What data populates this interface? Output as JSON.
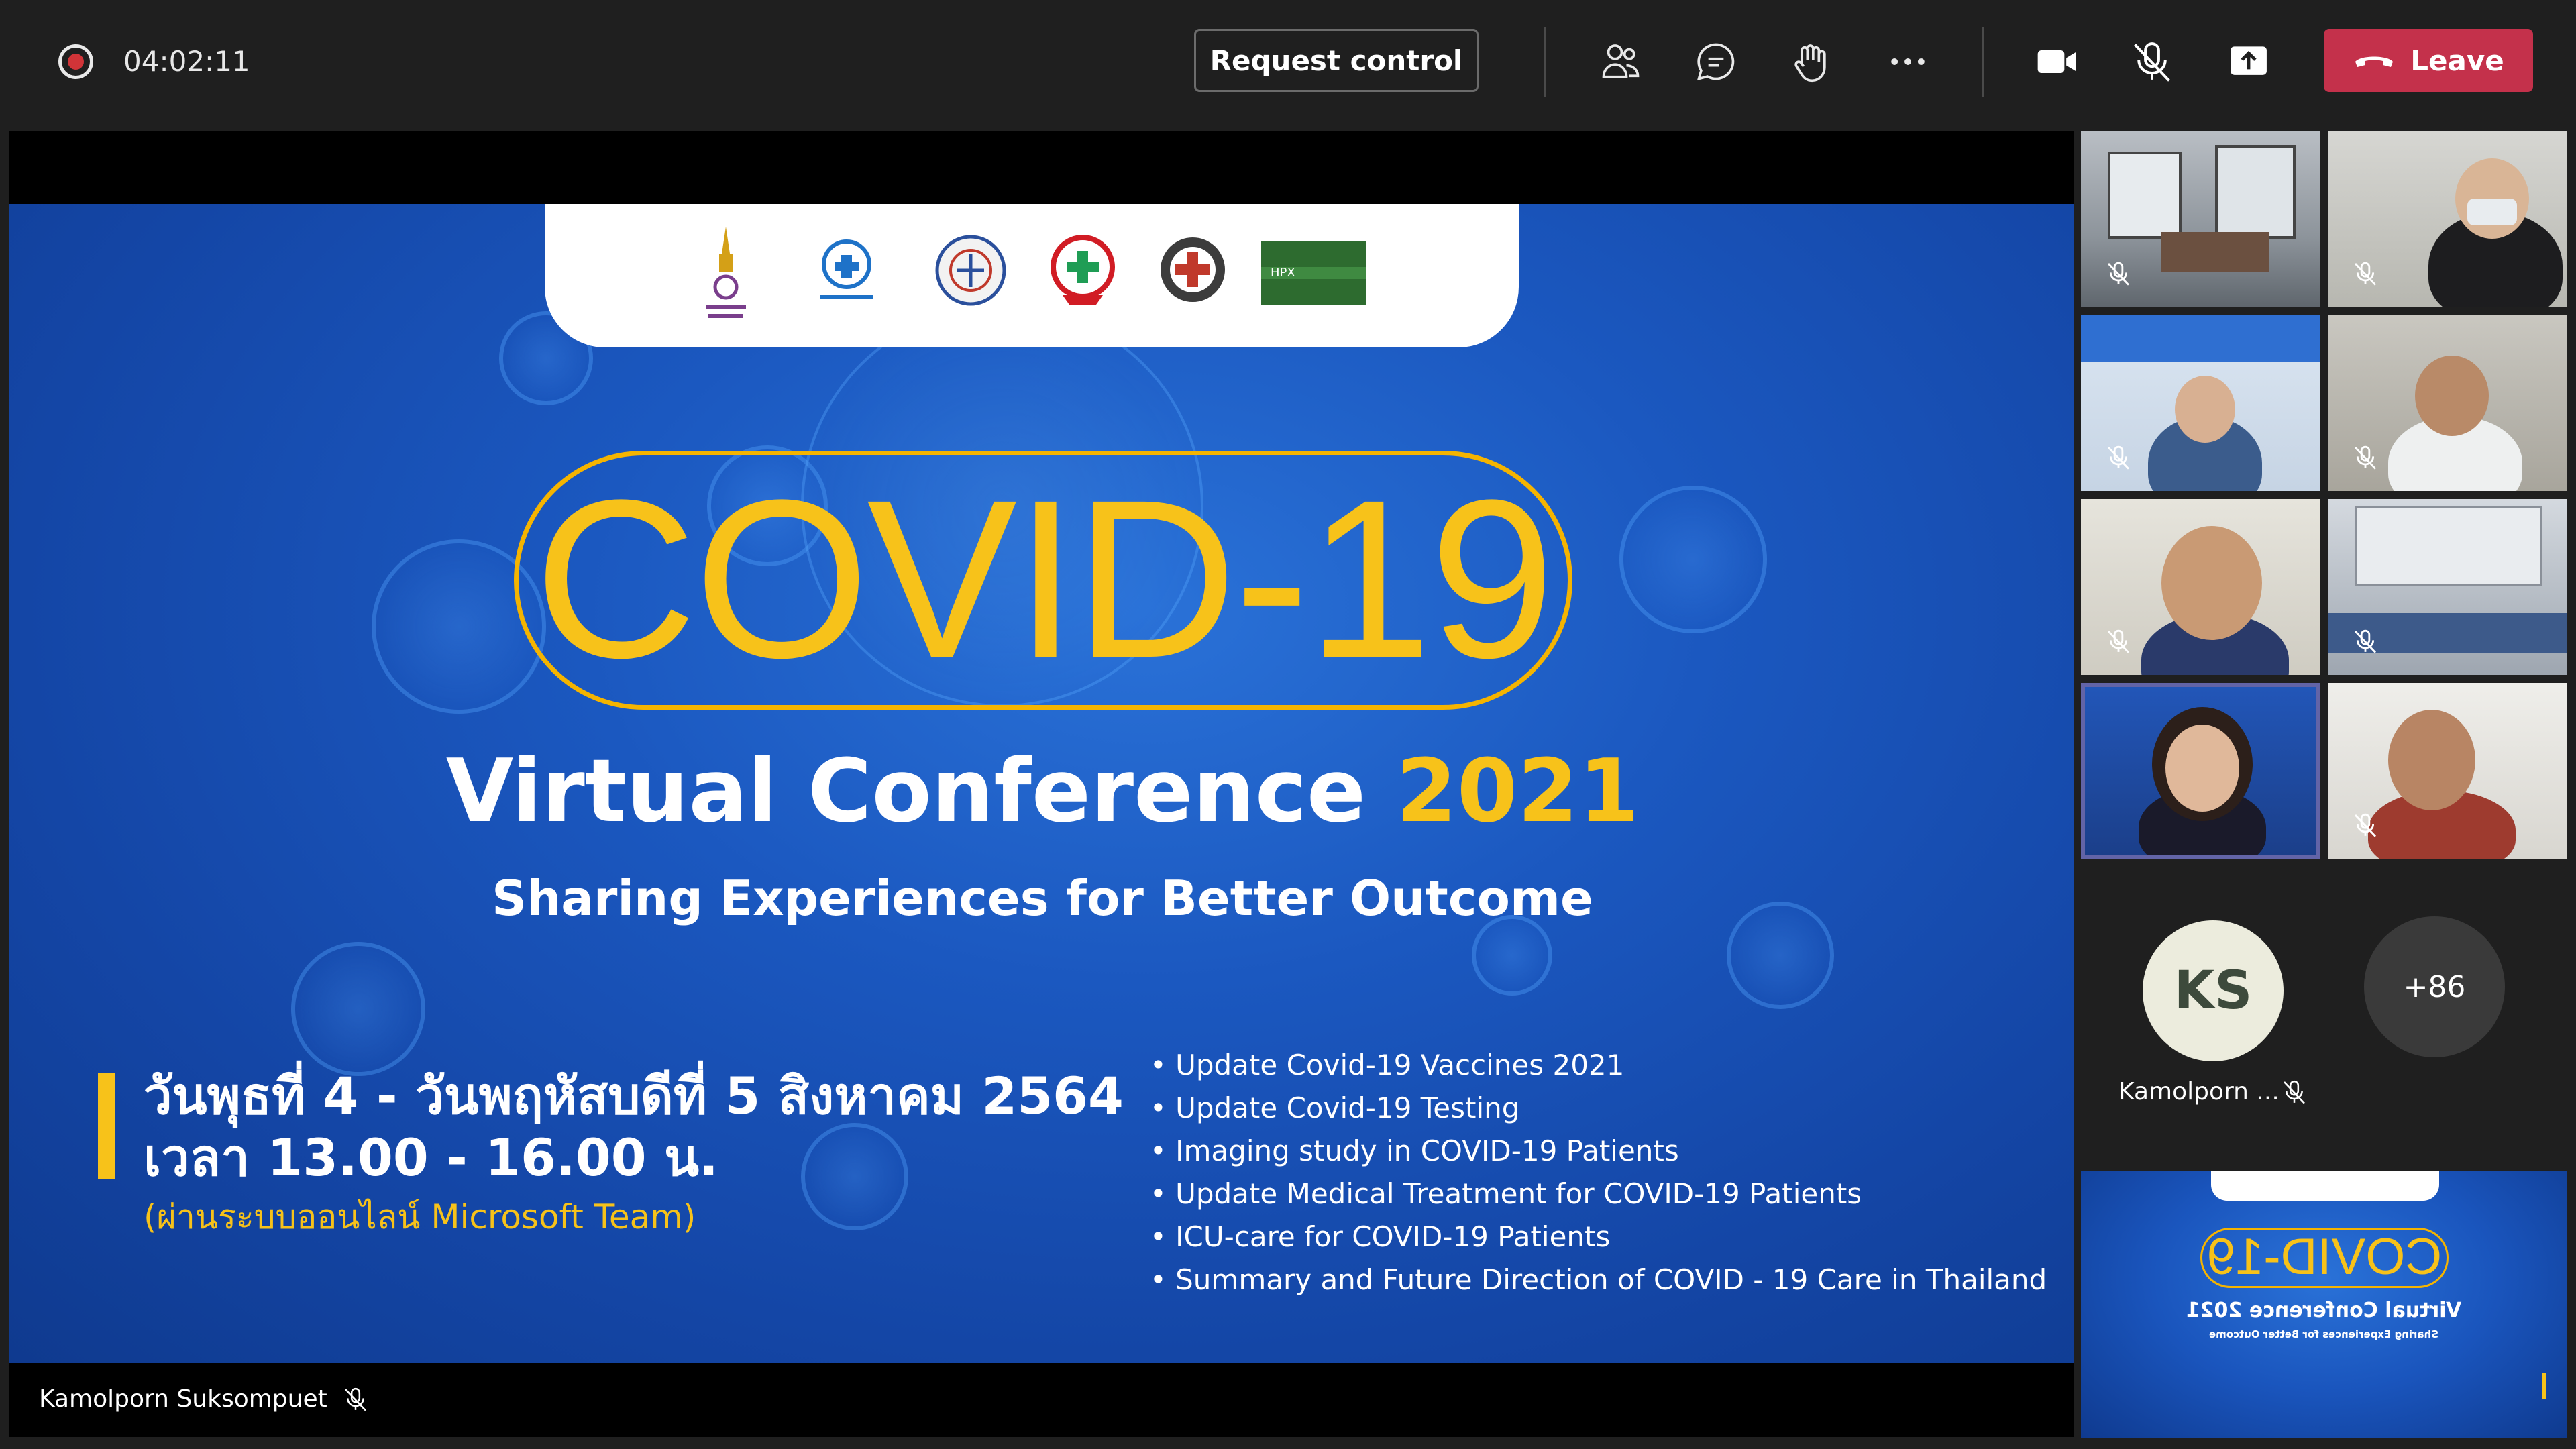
{
  "call": {
    "timer": "04:02:11",
    "request_control_label": "Request control",
    "leave_label": "Leave"
  },
  "toolbar_icons": [
    "people-icon",
    "chat-icon",
    "raise-hand-icon",
    "more-icon",
    "camera-icon",
    "mic-off-icon",
    "share-icon"
  ],
  "slide": {
    "covid_title": "COVID-19",
    "conference_title": "Virtual Conference",
    "conference_year": "2021",
    "subtitle": "Sharing Experiences for Better Outcome",
    "date_line_1": "วันพุธที่ 4 - วันพฤหัสบดีที่ 5 สิงหาคม 2564",
    "date_line_2": "เวลา 13.00 - 16.00 น.",
    "date_line_3": "(ผ่านระบบออนไลน์ Microsoft Team)",
    "topics": [
      "Update Covid-19 Vaccines 2021",
      "Update Covid-19 Testing",
      "Imaging study in COVID-19 Patients",
      "Update Medical Treatment for COVID-19 Patients",
      "ICU-care for COVID-19 Patients",
      " Summary and Future Direction of COVID - 19 Care in Thailand"
    ],
    "colors": {
      "background": "#1b58c0",
      "accent": "#f7c21a"
    }
  },
  "presenter": {
    "name": "Kamolporn Suksompuet"
  },
  "participants": {
    "avatar_initials": "KS",
    "avatar_name": "Kamolporn ...",
    "overflow_count": "+86"
  },
  "preview": {
    "covid_title": "COVID-19",
    "conference_title": "Virtual Conference 2021",
    "subtitle": "Sharing Experiences for Better Outcome"
  },
  "colors": {
    "leave": "#c4314b",
    "topbar": "#1f1f1f",
    "active_speaker": "#6264a7"
  }
}
